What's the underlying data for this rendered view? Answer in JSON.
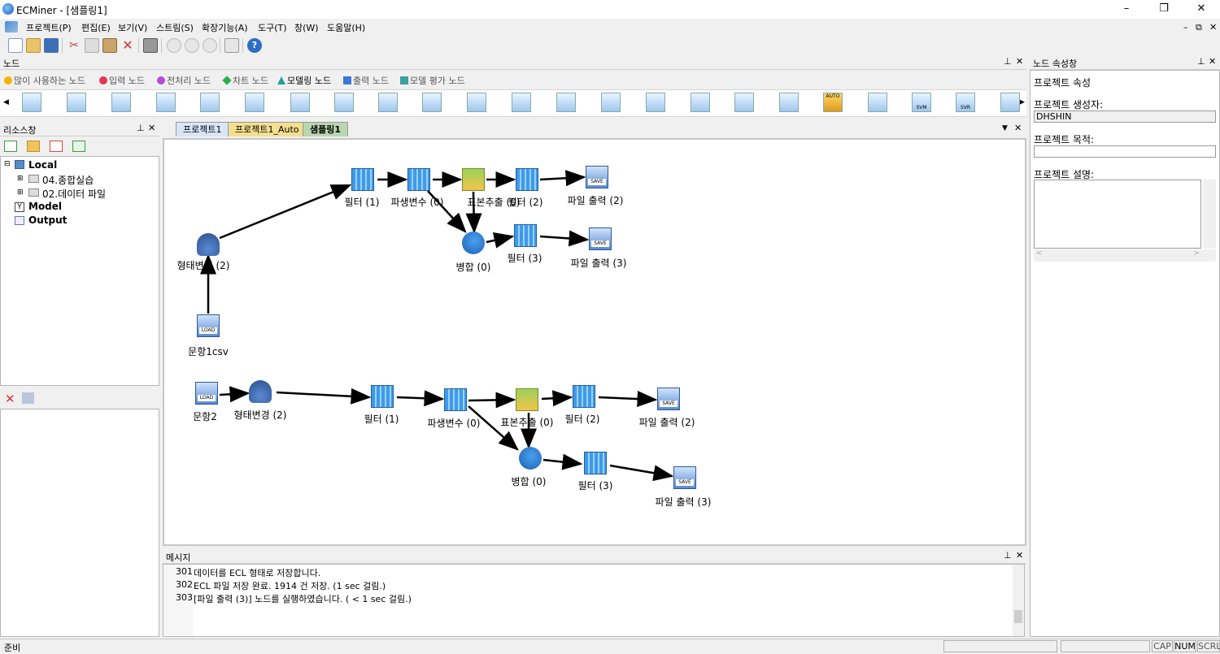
{
  "window": {
    "title": "ECMiner - [샘플링1]",
    "min": "–",
    "max": "❐",
    "close": "✕"
  },
  "menu": [
    "프로젝트(P)",
    "편집(E)",
    "보기(V)",
    "스트림(S)",
    "확장기능(A)",
    "도구(T)",
    "창(W)",
    "도움말(H)"
  ],
  "mdi_controls": {
    "min": "–",
    "restore": "⧉",
    "close": "✕"
  },
  "node_panel": {
    "title": "노드",
    "pin": "⊥",
    "close": "✕"
  },
  "node_categories": [
    {
      "label": "많이 사용하는 노드",
      "color": "#f5b400"
    },
    {
      "label": "입력 노드",
      "color": "#e8335b"
    },
    {
      "label": "전처리 노드",
      "color": "#b04fd6"
    },
    {
      "label": "차트 노드",
      "color": "#27b04a"
    },
    {
      "label": "모델링 노드",
      "color": "#1fa39a"
    },
    {
      "label": "출력 노드",
      "color": "#3a7ad6"
    },
    {
      "label": "모델 평가 노드",
      "color": "#3aa0a0"
    }
  ],
  "palette_labels": {
    "auto_ddr": "AUTO",
    "svm": "SVM",
    "svr": "SVR"
  },
  "resource_panel": {
    "title": "리소스창",
    "tree": [
      {
        "label": "Local",
        "bold": true
      },
      {
        "label": "04.종합실습",
        "bold": false
      },
      {
        "label": "02.데이터 파일",
        "bold": false
      },
      {
        "label": "Model",
        "bold": true
      },
      {
        "label": "Output",
        "bold": true
      }
    ]
  },
  "tabs": [
    "프로젝트1",
    "프로젝트1_Auto",
    "샘플링1"
  ],
  "canvas": {
    "stream1": {
      "load": "문항1csv",
      "transform": "형태변경 (2)",
      "filter1": "필터 (1)",
      "derive": "파생변수 (0)",
      "sample": "표본추출 (0)",
      "filter2": "필터 (2)",
      "out2": "파일 출력 (2)",
      "merge": "병합 (0)",
      "filter3": "필터 (3)",
      "out3": "파일 출력 (3)"
    },
    "stream2": {
      "load": "문항2",
      "transform": "형태변경 (2)",
      "filter1": "필터 (1)",
      "derive": "파생변수 (0)",
      "sample": "표본추출 (0)",
      "filter2": "필터 (2)",
      "out2": "파일 출력 (2)",
      "merge": "병합 (0)",
      "filter3": "필터 (3)",
      "out3": "파일 출력 (3)"
    },
    "icon_text": {
      "load": "LOAD",
      "save": "SAVE"
    }
  },
  "message_panel": {
    "title": "메시지",
    "lines": [
      {
        "no": "301",
        "text": "데이터를 ECL 형태로 저장합니다."
      },
      {
        "no": "302",
        "text": "ECL 파일 저장 완료. 1914 건 저장. (1 sec 걸림.)"
      },
      {
        "no": "303",
        "text": "[파일 출력 (3)] 노드를 실행하였습니다. ( < 1 sec 걸림.)"
      }
    ]
  },
  "property_panel": {
    "title": "노드 속성창",
    "section": "프로젝트 속성",
    "creator_label": "프로젝트 생성자:",
    "creator_value": "DHSHIN",
    "purpose_label": "프로젝트 목적:",
    "purpose_value": "",
    "desc_label": "프로젝트 설명:"
  },
  "statusbar": {
    "text": "준비",
    "cap": "CAP",
    "num": "NUM",
    "scrl": "SCRL"
  }
}
